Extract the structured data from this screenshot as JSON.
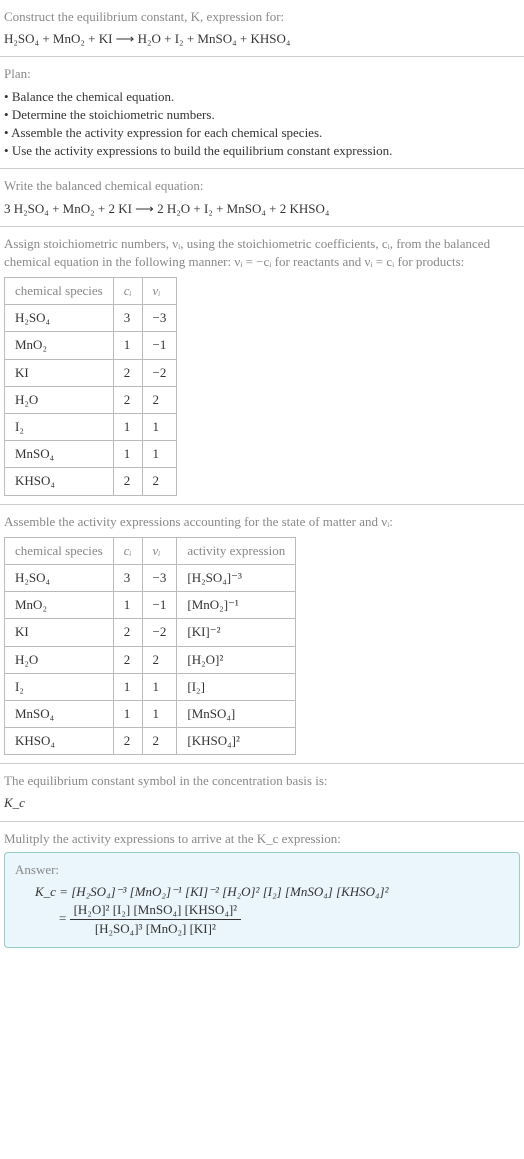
{
  "intro": {
    "heading": "Construct the equilibrium constant, K, expression for:",
    "equation": "H₂SO₄ + MnO₂ + KI ⟶ H₂O + I₂ + MnSO₄ + KHSO₄"
  },
  "plan": {
    "heading": "Plan:",
    "items": [
      "Balance the chemical equation.",
      "Determine the stoichiometric numbers.",
      "Assemble the activity expression for each chemical species.",
      "Use the activity expressions to build the equilibrium constant expression."
    ]
  },
  "balanced": {
    "heading": "Write the balanced chemical equation:",
    "equation": "3 H₂SO₄ + MnO₂ + 2 KI ⟶ 2 H₂O + I₂ + MnSO₄ + 2 KHSO₄"
  },
  "stoich_text": {
    "line": "Assign stoichiometric numbers, νᵢ, using the stoichiometric coefficients, cᵢ, from the balanced chemical equation in the following manner: νᵢ = −cᵢ for reactants and νᵢ = cᵢ for products:"
  },
  "stoich_table": {
    "headers": [
      "chemical species",
      "cᵢ",
      "νᵢ"
    ],
    "rows": [
      {
        "species": "H₂SO₄",
        "c": "3",
        "v": "−3"
      },
      {
        "species": "MnO₂",
        "c": "1",
        "v": "−1"
      },
      {
        "species": "KI",
        "c": "2",
        "v": "−2"
      },
      {
        "species": "H₂O",
        "c": "2",
        "v": "2"
      },
      {
        "species": "I₂",
        "c": "1",
        "v": "1"
      },
      {
        "species": "MnSO₄",
        "c": "1",
        "v": "1"
      },
      {
        "species": "KHSO₄",
        "c": "2",
        "v": "2"
      }
    ]
  },
  "activity_text": "Assemble the activity expressions accounting for the state of matter and νᵢ:",
  "activity_table": {
    "headers": [
      "chemical species",
      "cᵢ",
      "νᵢ",
      "activity expression"
    ],
    "rows": [
      {
        "species": "H₂SO₄",
        "c": "3",
        "v": "−3",
        "act": "[H₂SO₄]⁻³"
      },
      {
        "species": "MnO₂",
        "c": "1",
        "v": "−1",
        "act": "[MnO₂]⁻¹"
      },
      {
        "species": "KI",
        "c": "2",
        "v": "−2",
        "act": "[KI]⁻²"
      },
      {
        "species": "H₂O",
        "c": "2",
        "v": "2",
        "act": "[H₂O]²"
      },
      {
        "species": "I₂",
        "c": "1",
        "v": "1",
        "act": "[I₂]"
      },
      {
        "species": "MnSO₄",
        "c": "1",
        "v": "1",
        "act": "[MnSO₄]"
      },
      {
        "species": "KHSO₄",
        "c": "2",
        "v": "2",
        "act": "[KHSO₄]²"
      }
    ]
  },
  "symbol_text": "The equilibrium constant symbol in the concentration basis is:",
  "symbol": "K_c",
  "multiply_text": "Mulitply the activity expressions to arrive at the K_c expression:",
  "answer": {
    "label": "Answer:",
    "line1": "K_c = [H₂SO₄]⁻³ [MnO₂]⁻¹ [KI]⁻² [H₂O]² [I₂] [MnSO₄] [KHSO₄]²",
    "frac_num": "[H₂O]² [I₂] [MnSO₄] [KHSO₄]²",
    "frac_den": "[H₂SO₄]³ [MnO₂] [KI]²",
    "eq_prefix": "= "
  },
  "chart_data": {
    "type": "table",
    "tables": [
      {
        "title": "Stoichiometric numbers",
        "columns": [
          "chemical species",
          "c_i",
          "ν_i"
        ],
        "rows": [
          [
            "H2SO4",
            3,
            -3
          ],
          [
            "MnO2",
            1,
            -1
          ],
          [
            "KI",
            2,
            -2
          ],
          [
            "H2O",
            2,
            2
          ],
          [
            "I2",
            1,
            1
          ],
          [
            "MnSO4",
            1,
            1
          ],
          [
            "KHSO4",
            2,
            2
          ]
        ]
      },
      {
        "title": "Activity expressions",
        "columns": [
          "chemical species",
          "c_i",
          "ν_i",
          "activity expression"
        ],
        "rows": [
          [
            "H2SO4",
            3,
            -3,
            "[H2SO4]^-3"
          ],
          [
            "MnO2",
            1,
            -1,
            "[MnO2]^-1"
          ],
          [
            "KI",
            2,
            -2,
            "[KI]^-2"
          ],
          [
            "H2O",
            2,
            2,
            "[H2O]^2"
          ],
          [
            "I2",
            1,
            1,
            "[I2]"
          ],
          [
            "MnSO4",
            1,
            1,
            "[MnSO4]"
          ],
          [
            "KHSO4",
            2,
            2,
            "[KHSO4]^2"
          ]
        ]
      }
    ]
  }
}
